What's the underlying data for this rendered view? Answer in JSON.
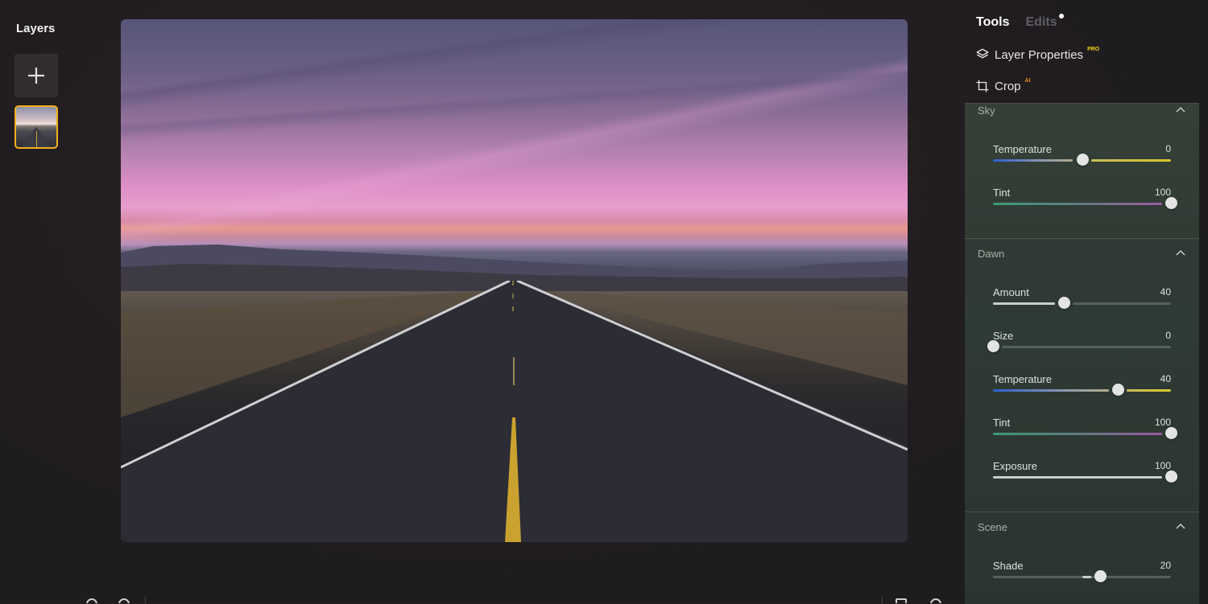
{
  "layers": {
    "title": "Layers",
    "add_button_icon": "plus-icon",
    "items": [
      {
        "name": "road-sunset-photo",
        "selected": true
      }
    ]
  },
  "tools_panel": {
    "tabs": [
      {
        "label": "Tools",
        "active": true
      },
      {
        "label": "Edits",
        "active": false,
        "has_notification_dot": true
      }
    ],
    "tool_items": [
      {
        "label": "Layer Properties",
        "icon": "layers-icon",
        "badge": "PRO"
      },
      {
        "label": "Crop",
        "icon": "crop-icon",
        "badge": "AI"
      }
    ],
    "sections": [
      {
        "title": "Sky",
        "expanded": true,
        "sliders": [
          {
            "label": "Temperature",
            "value": 0,
            "min": -100,
            "max": 100,
            "style": "temperature"
          },
          {
            "label": "Tint",
            "value": 100,
            "min": -100,
            "max": 100,
            "style": "tint"
          }
        ]
      },
      {
        "title": "Dawn",
        "expanded": true,
        "sliders": [
          {
            "label": "Amount",
            "value": 40,
            "min": 0,
            "max": 100,
            "style": "plain"
          },
          {
            "label": "Size",
            "value": 0,
            "min": 0,
            "max": 100,
            "style": "plain"
          },
          {
            "label": "Temperature",
            "value": 40,
            "min": -100,
            "max": 100,
            "style": "temperature"
          },
          {
            "label": "Tint",
            "value": 100,
            "min": -100,
            "max": 100,
            "style": "tint"
          },
          {
            "label": "Exposure",
            "value": 100,
            "min": -100,
            "max": 100,
            "style": "plain-full"
          }
        ]
      },
      {
        "title": "Scene",
        "expanded": true,
        "sliders": [
          {
            "label": "Shade",
            "value": 20,
            "min": -100,
            "max": 100,
            "style": "bipolar"
          }
        ]
      }
    ]
  },
  "canvas": {
    "image_description": "Empty highway at sunset under a pink and purple sky"
  },
  "colors": {
    "accent_selected": "#f0b21a",
    "pro_badge": "#f2d21a",
    "ai_badge": "#f08a1a"
  }
}
